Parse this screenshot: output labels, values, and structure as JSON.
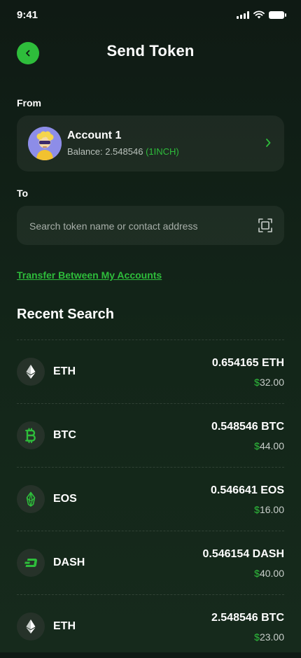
{
  "status_bar": {
    "time": "9:41"
  },
  "header": {
    "title": "Send Token"
  },
  "from": {
    "label": "From",
    "account_name": "Account 1",
    "balance_prefix": "Balance: 2.548546",
    "balance_unit": "(1INCH)"
  },
  "to": {
    "label": "To",
    "search_placeholder": "Search token name or contact address"
  },
  "transfer_link": "Transfer Between My Accounts",
  "recent": {
    "title": "Recent Search",
    "items": [
      {
        "symbol": "ETH",
        "icon": "ethereum-icon",
        "amount": "0.654165 ETH",
        "currency_sign": "$",
        "usd_value": "32.00"
      },
      {
        "symbol": "BTC",
        "icon": "bitcoin-icon",
        "amount": "0.548546 BTC",
        "currency_sign": "$",
        "usd_value": "44.00"
      },
      {
        "symbol": "EOS",
        "icon": "eos-icon",
        "amount": "0.546641 EOS",
        "currency_sign": "$",
        "usd_value": "16.00"
      },
      {
        "symbol": "DASH",
        "icon": "dash-icon",
        "amount": "0.546154 DASH",
        "currency_sign": "$",
        "usd_value": "40.00"
      },
      {
        "symbol": "ETH",
        "icon": "ethereum-icon",
        "amount": "2.548546 BTC",
        "currency_sign": "$",
        "usd_value": "23.00"
      }
    ]
  },
  "colors": {
    "accent": "#2ebd3b",
    "background_top": "#0f1a14",
    "background_bottom": "#162a1c",
    "card": "#1b2620"
  }
}
